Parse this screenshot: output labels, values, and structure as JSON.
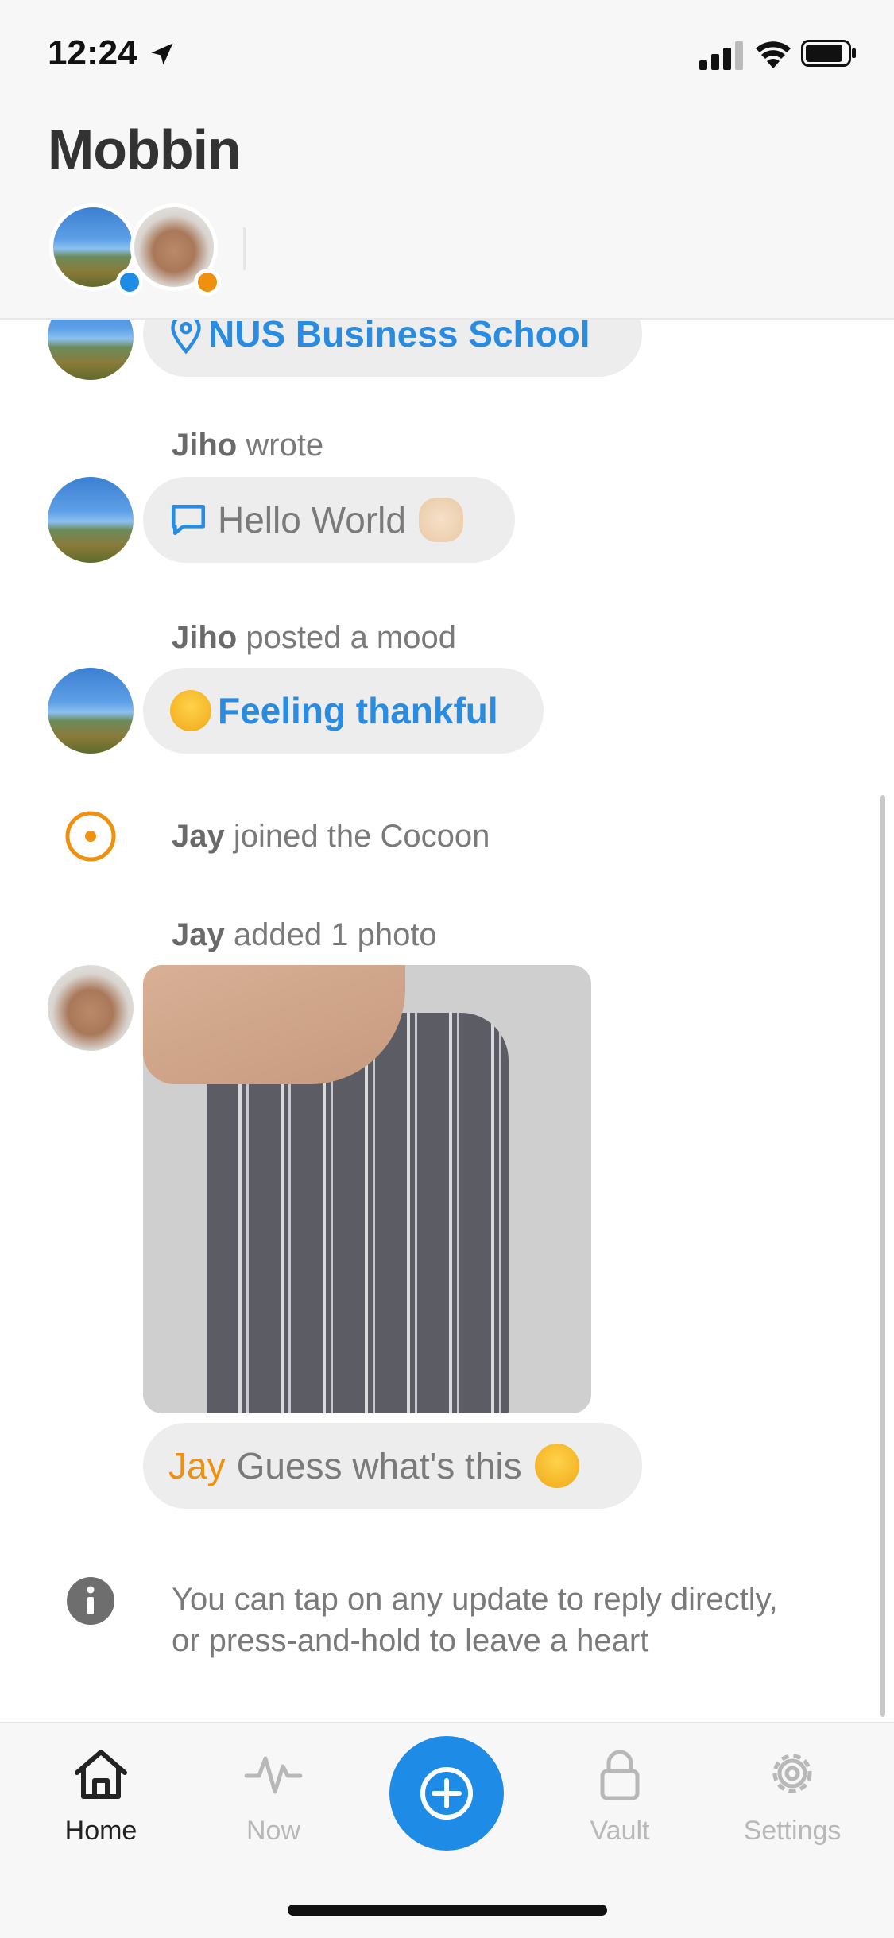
{
  "status": {
    "time": "12:24"
  },
  "header": {
    "title": "Mobbin"
  },
  "feed": {
    "location_item": {
      "label": "NUS Business School"
    },
    "wrote_item": {
      "author": "Jiho",
      "action": "wrote",
      "message": "Hello World"
    },
    "mood_item": {
      "author": "Jiho",
      "action": "posted a mood",
      "mood": "Feeling thankful"
    },
    "joined_item": {
      "author": "Jay",
      "action": "joined the Cocoon"
    },
    "photo_item": {
      "author": "Jay",
      "action": "added 1 photo",
      "caption_author": "Jay",
      "caption_text": "Guess what's this"
    },
    "tip": {
      "line1": "You can tap on any update to reply directly,",
      "line2": "or press-and-hold to leave a heart"
    }
  },
  "tabbar": {
    "tabs": [
      {
        "label": "Home",
        "icon": "home-icon",
        "active": true
      },
      {
        "label": "Now",
        "icon": "pulse-icon",
        "active": false
      },
      {
        "label": "Vault",
        "icon": "lock-icon",
        "active": false
      },
      {
        "label": "Settings",
        "icon": "gear-icon",
        "active": false
      }
    ],
    "fab_icon": "plus-circle-icon"
  },
  "colors": {
    "accent_blue": "#1e8ce6",
    "orange": "#f0900f",
    "bubble_bg": "#ededed"
  }
}
